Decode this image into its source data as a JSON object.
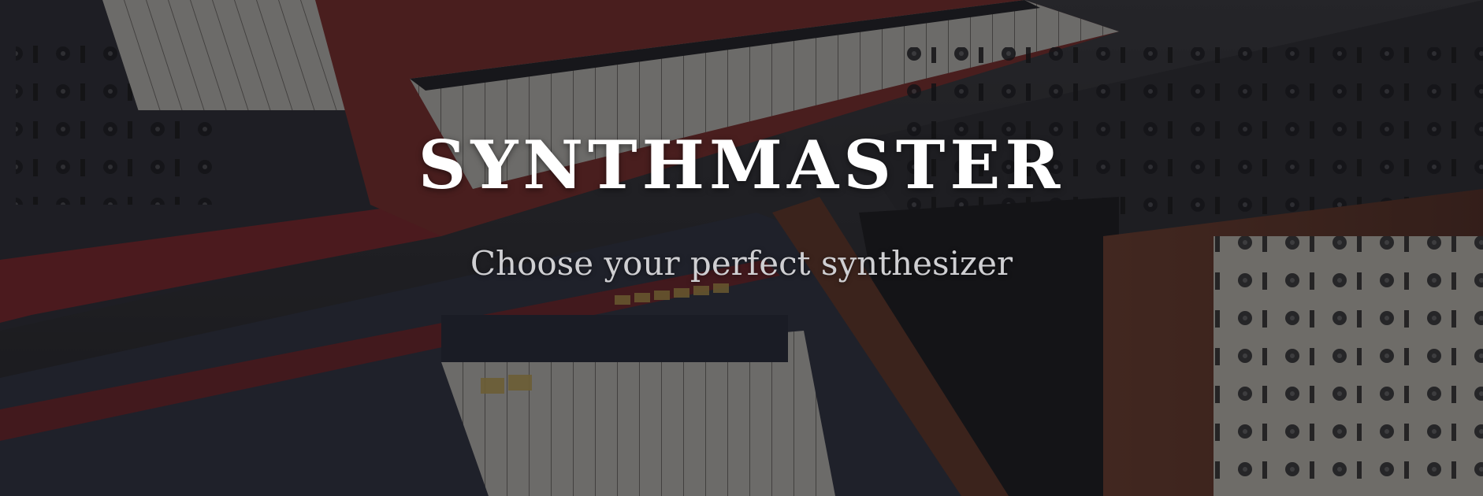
{
  "hero": {
    "title": "SYNTHMASTER",
    "subtitle": "Choose your perfect synthesizer"
  },
  "background": {
    "image_subject": "collection of vintage synthesizers",
    "overlay_color": "#141418"
  },
  "colors": {
    "title": "#ffffff",
    "subtitle": "#cfcfd2",
    "synth_red": "#8a2a26",
    "synth_wood": "#6a3a28",
    "synth_panel": "#2d3140"
  }
}
